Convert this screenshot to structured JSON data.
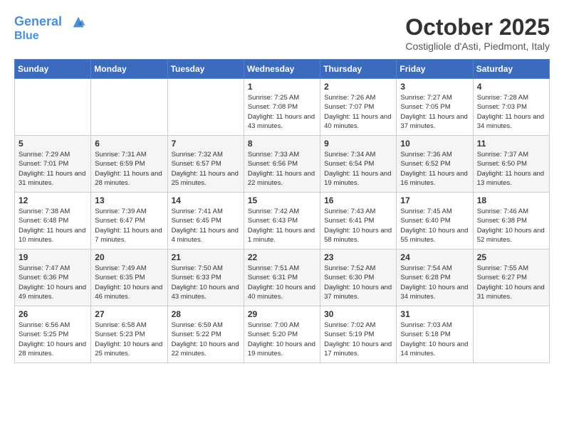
{
  "header": {
    "logo_line1": "General",
    "logo_line2": "Blue",
    "month_title": "October 2025",
    "location": "Costigliole d'Asti, Piedmont, Italy"
  },
  "days_of_week": [
    "Sunday",
    "Monday",
    "Tuesday",
    "Wednesday",
    "Thursday",
    "Friday",
    "Saturday"
  ],
  "weeks": [
    [
      {
        "day": "",
        "info": ""
      },
      {
        "day": "",
        "info": ""
      },
      {
        "day": "",
        "info": ""
      },
      {
        "day": "1",
        "info": "Sunrise: 7:25 AM\nSunset: 7:08 PM\nDaylight: 11 hours and 43 minutes."
      },
      {
        "day": "2",
        "info": "Sunrise: 7:26 AM\nSunset: 7:07 PM\nDaylight: 11 hours and 40 minutes."
      },
      {
        "day": "3",
        "info": "Sunrise: 7:27 AM\nSunset: 7:05 PM\nDaylight: 11 hours and 37 minutes."
      },
      {
        "day": "4",
        "info": "Sunrise: 7:28 AM\nSunset: 7:03 PM\nDaylight: 11 hours and 34 minutes."
      }
    ],
    [
      {
        "day": "5",
        "info": "Sunrise: 7:29 AM\nSunset: 7:01 PM\nDaylight: 11 hours and 31 minutes."
      },
      {
        "day": "6",
        "info": "Sunrise: 7:31 AM\nSunset: 6:59 PM\nDaylight: 11 hours and 28 minutes."
      },
      {
        "day": "7",
        "info": "Sunrise: 7:32 AM\nSunset: 6:57 PM\nDaylight: 11 hours and 25 minutes."
      },
      {
        "day": "8",
        "info": "Sunrise: 7:33 AM\nSunset: 6:56 PM\nDaylight: 11 hours and 22 minutes."
      },
      {
        "day": "9",
        "info": "Sunrise: 7:34 AM\nSunset: 6:54 PM\nDaylight: 11 hours and 19 minutes."
      },
      {
        "day": "10",
        "info": "Sunrise: 7:36 AM\nSunset: 6:52 PM\nDaylight: 11 hours and 16 minutes."
      },
      {
        "day": "11",
        "info": "Sunrise: 7:37 AM\nSunset: 6:50 PM\nDaylight: 11 hours and 13 minutes."
      }
    ],
    [
      {
        "day": "12",
        "info": "Sunrise: 7:38 AM\nSunset: 6:48 PM\nDaylight: 11 hours and 10 minutes."
      },
      {
        "day": "13",
        "info": "Sunrise: 7:39 AM\nSunset: 6:47 PM\nDaylight: 11 hours and 7 minutes."
      },
      {
        "day": "14",
        "info": "Sunrise: 7:41 AM\nSunset: 6:45 PM\nDaylight: 11 hours and 4 minutes."
      },
      {
        "day": "15",
        "info": "Sunrise: 7:42 AM\nSunset: 6:43 PM\nDaylight: 11 hours and 1 minute."
      },
      {
        "day": "16",
        "info": "Sunrise: 7:43 AM\nSunset: 6:41 PM\nDaylight: 10 hours and 58 minutes."
      },
      {
        "day": "17",
        "info": "Sunrise: 7:45 AM\nSunset: 6:40 PM\nDaylight: 10 hours and 55 minutes."
      },
      {
        "day": "18",
        "info": "Sunrise: 7:46 AM\nSunset: 6:38 PM\nDaylight: 10 hours and 52 minutes."
      }
    ],
    [
      {
        "day": "19",
        "info": "Sunrise: 7:47 AM\nSunset: 6:36 PM\nDaylight: 10 hours and 49 minutes."
      },
      {
        "day": "20",
        "info": "Sunrise: 7:49 AM\nSunset: 6:35 PM\nDaylight: 10 hours and 46 minutes."
      },
      {
        "day": "21",
        "info": "Sunrise: 7:50 AM\nSunset: 6:33 PM\nDaylight: 10 hours and 43 minutes."
      },
      {
        "day": "22",
        "info": "Sunrise: 7:51 AM\nSunset: 6:31 PM\nDaylight: 10 hours and 40 minutes."
      },
      {
        "day": "23",
        "info": "Sunrise: 7:52 AM\nSunset: 6:30 PM\nDaylight: 10 hours and 37 minutes."
      },
      {
        "day": "24",
        "info": "Sunrise: 7:54 AM\nSunset: 6:28 PM\nDaylight: 10 hours and 34 minutes."
      },
      {
        "day": "25",
        "info": "Sunrise: 7:55 AM\nSunset: 6:27 PM\nDaylight: 10 hours and 31 minutes."
      }
    ],
    [
      {
        "day": "26",
        "info": "Sunrise: 6:56 AM\nSunset: 5:25 PM\nDaylight: 10 hours and 28 minutes."
      },
      {
        "day": "27",
        "info": "Sunrise: 6:58 AM\nSunset: 5:23 PM\nDaylight: 10 hours and 25 minutes."
      },
      {
        "day": "28",
        "info": "Sunrise: 6:59 AM\nSunset: 5:22 PM\nDaylight: 10 hours and 22 minutes."
      },
      {
        "day": "29",
        "info": "Sunrise: 7:00 AM\nSunset: 5:20 PM\nDaylight: 10 hours and 19 minutes."
      },
      {
        "day": "30",
        "info": "Sunrise: 7:02 AM\nSunset: 5:19 PM\nDaylight: 10 hours and 17 minutes."
      },
      {
        "day": "31",
        "info": "Sunrise: 7:03 AM\nSunset: 5:18 PM\nDaylight: 10 hours and 14 minutes."
      },
      {
        "day": "",
        "info": ""
      }
    ]
  ]
}
